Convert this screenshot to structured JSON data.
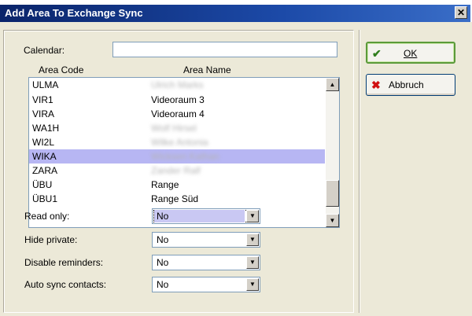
{
  "window": {
    "title": "Add Area To Exchange Sync",
    "close_glyph": "✕"
  },
  "calendar": {
    "label": "Calendar:",
    "value": ""
  },
  "list": {
    "headers": {
      "code": "Area Code",
      "name": "Area Name"
    },
    "rows": [
      {
        "code": "ULMA",
        "name": "Ulrich Marks",
        "obscured": true
      },
      {
        "code": "VIR1",
        "name": "Videoraum 3",
        "obscured": false
      },
      {
        "code": "VIRA",
        "name": "Videoraum 4",
        "obscured": false
      },
      {
        "code": "WA1H",
        "name": "Wolf Hirsel",
        "obscured": true
      },
      {
        "code": "WI2L",
        "name": "Wilke Antonia",
        "obscured": true
      },
      {
        "code": "WIKA",
        "name": "Wicksen Kathan",
        "obscured": true,
        "selected": true
      },
      {
        "code": "ZARA",
        "name": "Zander Ralf",
        "obscured": true
      },
      {
        "code": "ÜBU",
        "name": "Range",
        "obscured": false
      },
      {
        "code": "ÜBU1",
        "name": "Range Süd",
        "obscured": false
      }
    ]
  },
  "options": {
    "read_only": {
      "label": "Read only:",
      "value": "No"
    },
    "hide_private": {
      "label": "Hide private:",
      "value": "No"
    },
    "disable_reminders": {
      "label": "Disable reminders:",
      "value": "No"
    },
    "auto_sync_contacts": {
      "label": "Auto sync contacts:",
      "value": "No"
    }
  },
  "buttons": {
    "ok": {
      "label": "OK",
      "icon": "check-icon"
    },
    "cancel": {
      "label": "Abbruch",
      "icon": "x-icon"
    }
  },
  "colors": {
    "title_bar": "#0a246a",
    "selection": "#b7b6f3",
    "ok_icon": "#2f7d1c",
    "cancel_icon": "#d01010"
  }
}
